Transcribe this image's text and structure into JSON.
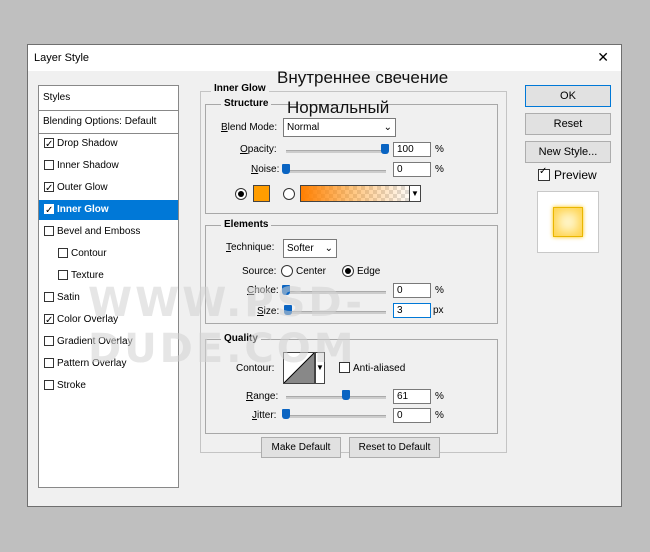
{
  "window": {
    "title": "Layer Style",
    "close_glyph": "✕"
  },
  "overlay": {
    "heading_ru": "Внутреннее свечение",
    "blendmode_ru": "Нормальный",
    "watermark": "WWW.PSD-DUDE.COM"
  },
  "left_panel": {
    "styles_label": "Styles",
    "blending_label": "Blending Options: Default",
    "items": [
      {
        "label": "Drop Shadow",
        "checked": true
      },
      {
        "label": "Inner Shadow",
        "checked": false
      },
      {
        "label": "Outer Glow",
        "checked": true
      },
      {
        "label": "Inner Glow",
        "checked": true,
        "selected": true
      },
      {
        "label": "Bevel and Emboss",
        "checked": false
      },
      {
        "label": "Contour",
        "checked": false,
        "sub": true
      },
      {
        "label": "Texture",
        "checked": false,
        "sub": true
      },
      {
        "label": "Satin",
        "checked": false
      },
      {
        "label": "Color Overlay",
        "checked": true
      },
      {
        "label": "Gradient Overlay",
        "checked": false
      },
      {
        "label": "Pattern Overlay",
        "checked": false
      },
      {
        "label": "Stroke",
        "checked": false
      }
    ]
  },
  "inner_glow": {
    "title": "Inner Glow",
    "structure": {
      "title": "Structure",
      "blend_mode_label": "Blend Mode:",
      "blend_mode_value": "Normal",
      "opacity_label": "Opacity:",
      "opacity_value": "100",
      "opacity_level": 1.0,
      "noise_label": "Noise:",
      "noise_value": "0",
      "noise_level": 0.0,
      "percent": "%",
      "glow_color": "#ff9d00"
    },
    "elements": {
      "title": "Elements",
      "technique_label": "Technique:",
      "technique_value": "Softer",
      "source_label": "Source:",
      "source_center": "Center",
      "source_edge": "Edge",
      "choke_label": "Choke:",
      "choke_value": "0",
      "choke_level": 0.0,
      "size_label": "Size:",
      "size_value": "3",
      "size_level": 0.02,
      "percent": "%",
      "px": "px"
    },
    "quality": {
      "title": "Quality",
      "contour_label": "Contour:",
      "anti_aliased_label": "Anti-aliased",
      "range_label": "Range:",
      "range_value": "61",
      "range_level": 0.61,
      "jitter_label": "Jitter:",
      "jitter_value": "0",
      "jitter_level": 0.0,
      "percent": "%"
    },
    "make_default": "Make Default",
    "reset_default": "Reset to Default"
  },
  "right_buttons": {
    "ok": "OK",
    "reset": "Reset",
    "new_style": "New Style...",
    "preview_label": "Preview"
  },
  "colors": {
    "accent": "#0078d7",
    "glow": "#ff9d00"
  }
}
